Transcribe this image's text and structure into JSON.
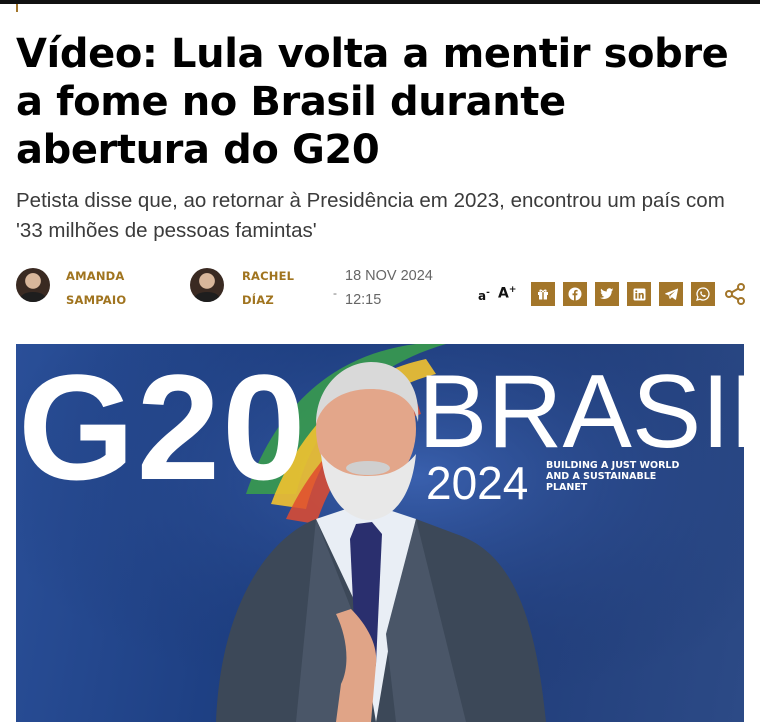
{
  "article": {
    "headline": "Vídeo: Lula volta a mentir sobre a fome no Brasil durante abertura do G20",
    "subtitle": "Petista disse que, ao retornar à Presidência em 2023, encontrou um país com '33 milhões de pessoas famintas'"
  },
  "authors": [
    {
      "name": "AMANDA SAMPAIO"
    },
    {
      "name": "RACHEL DÍAZ"
    }
  ],
  "meta": {
    "separator": "-",
    "date": "18 NOV 2024",
    "time": "12:15"
  },
  "font_controls": {
    "decrease": "a",
    "increase": "A",
    "decrease_sign": "-",
    "increase_sign": "+"
  },
  "share": {
    "buttons": [
      "gift-icon",
      "facebook-icon",
      "twitter-icon",
      "linkedin-icon",
      "telegram-icon",
      "whatsapp-icon"
    ],
    "more": "share-icon"
  },
  "photo": {
    "sign_g20": "G20",
    "sign_brasil": "BRASIL",
    "sign_year": "2024",
    "sign_tagline": "BUILDING A JUST WORLD AND A SUSTAINABLE PLANET"
  },
  "colors": {
    "accent": "#a3762a",
    "headline": "#000000",
    "subtitle": "#3b3b3b"
  }
}
